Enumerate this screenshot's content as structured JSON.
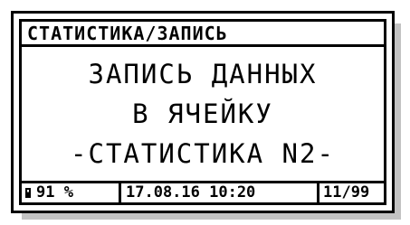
{
  "screen": {
    "title": "СТАТИСТИКА/ЗАПИСЬ",
    "message_lines": [
      "ЗАПИСЬ ДАННЫХ",
      "В ЯЧЕЙКУ",
      "-СТАТИСТИКА N2-"
    ]
  },
  "status_bar": {
    "battery_icon": "battery-icon",
    "battery_percent": "91 %",
    "battery_level": 0.91,
    "datetime": "17.08.16 10:20",
    "record_counter": "11/99"
  }
}
